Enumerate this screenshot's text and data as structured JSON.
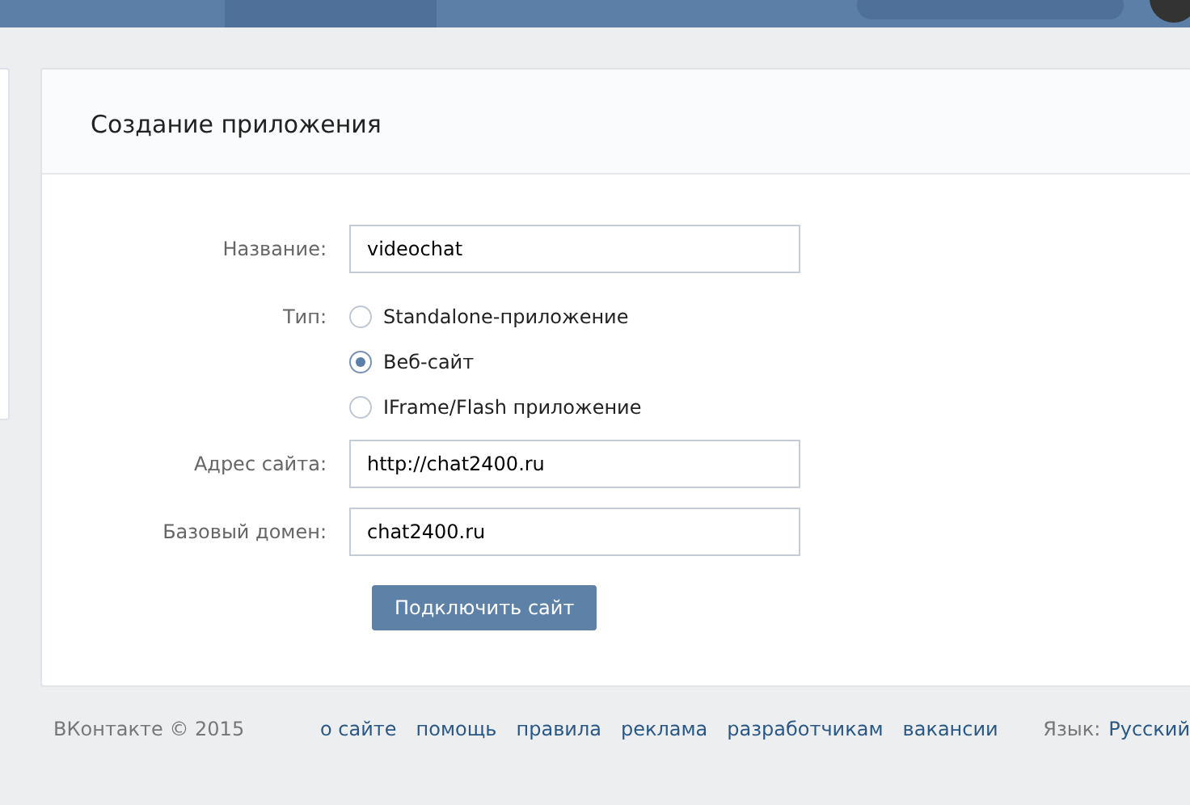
{
  "page_title": "Создание приложения",
  "form": {
    "fields": [
      {
        "kind": "text",
        "label": "Название:",
        "value": "videochat"
      },
      {
        "kind": "radio",
        "label": "Тип:",
        "options": [
          {
            "label": "Standalone-приложение",
            "selected": false
          },
          {
            "label": "Веб-сайт",
            "selected": true
          },
          {
            "label": "IFrame/Flash приложение",
            "selected": false
          }
        ]
      },
      {
        "kind": "text",
        "label": "Адрес сайта:",
        "value": "http://chat2400.ru"
      },
      {
        "kind": "text",
        "label": "Базовый домен:",
        "value": "chat2400.ru"
      }
    ],
    "submit": "Подключить сайт"
  },
  "footer": {
    "copyright": "ВКонтакте © 2015",
    "links": [
      "о сайте",
      "помощь",
      "правила",
      "реклама",
      "разработчикам",
      "вакансии"
    ],
    "language_label": "Язык:",
    "language": "Русский"
  }
}
